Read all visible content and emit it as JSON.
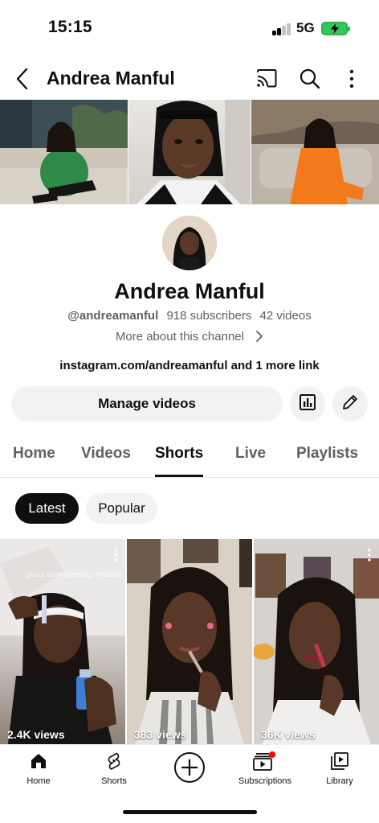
{
  "status": {
    "time": "15:15",
    "network": "5G"
  },
  "header": {
    "title": "Andrea Manful"
  },
  "channel": {
    "name": "Andrea Manful",
    "handle": "@andreamanful",
    "subscribers": "918 subscribers",
    "videos": "42 videos",
    "more_about": "More about this channel",
    "links": "instagram.com/andreamanful and 1 more link",
    "manage_label": "Manage videos"
  },
  "tabs": [
    {
      "label": "Home"
    },
    {
      "label": "Videos"
    },
    {
      "label": "Shorts"
    },
    {
      "label": "Live"
    },
    {
      "label": "Playlists"
    }
  ],
  "active_tab": "Shorts",
  "chips": {
    "latest": "Latest",
    "popular": "Popular"
  },
  "shorts": [
    {
      "views": "2.4K views",
      "caption": "glass skin evening routine"
    },
    {
      "views": "383 views"
    },
    {
      "views": "36K views"
    }
  ],
  "nav": {
    "home": "Home",
    "shorts": "Shorts",
    "subscriptions": "Subscriptions",
    "library": "Library"
  },
  "colors": {
    "text_primary": "#0f0f0f",
    "text_secondary": "#606060",
    "chip_bg": "#f2f2f2",
    "notification_dot": "#ff0000",
    "battery": "#33c659"
  },
  "icons": [
    "back-icon",
    "cast-icon",
    "search-icon",
    "more-vert-icon",
    "chevron-right-icon",
    "analytics-icon",
    "edit-pencil-icon",
    "home-icon",
    "shorts-icon",
    "create-plus-icon",
    "subscriptions-icon",
    "library-icon"
  ]
}
